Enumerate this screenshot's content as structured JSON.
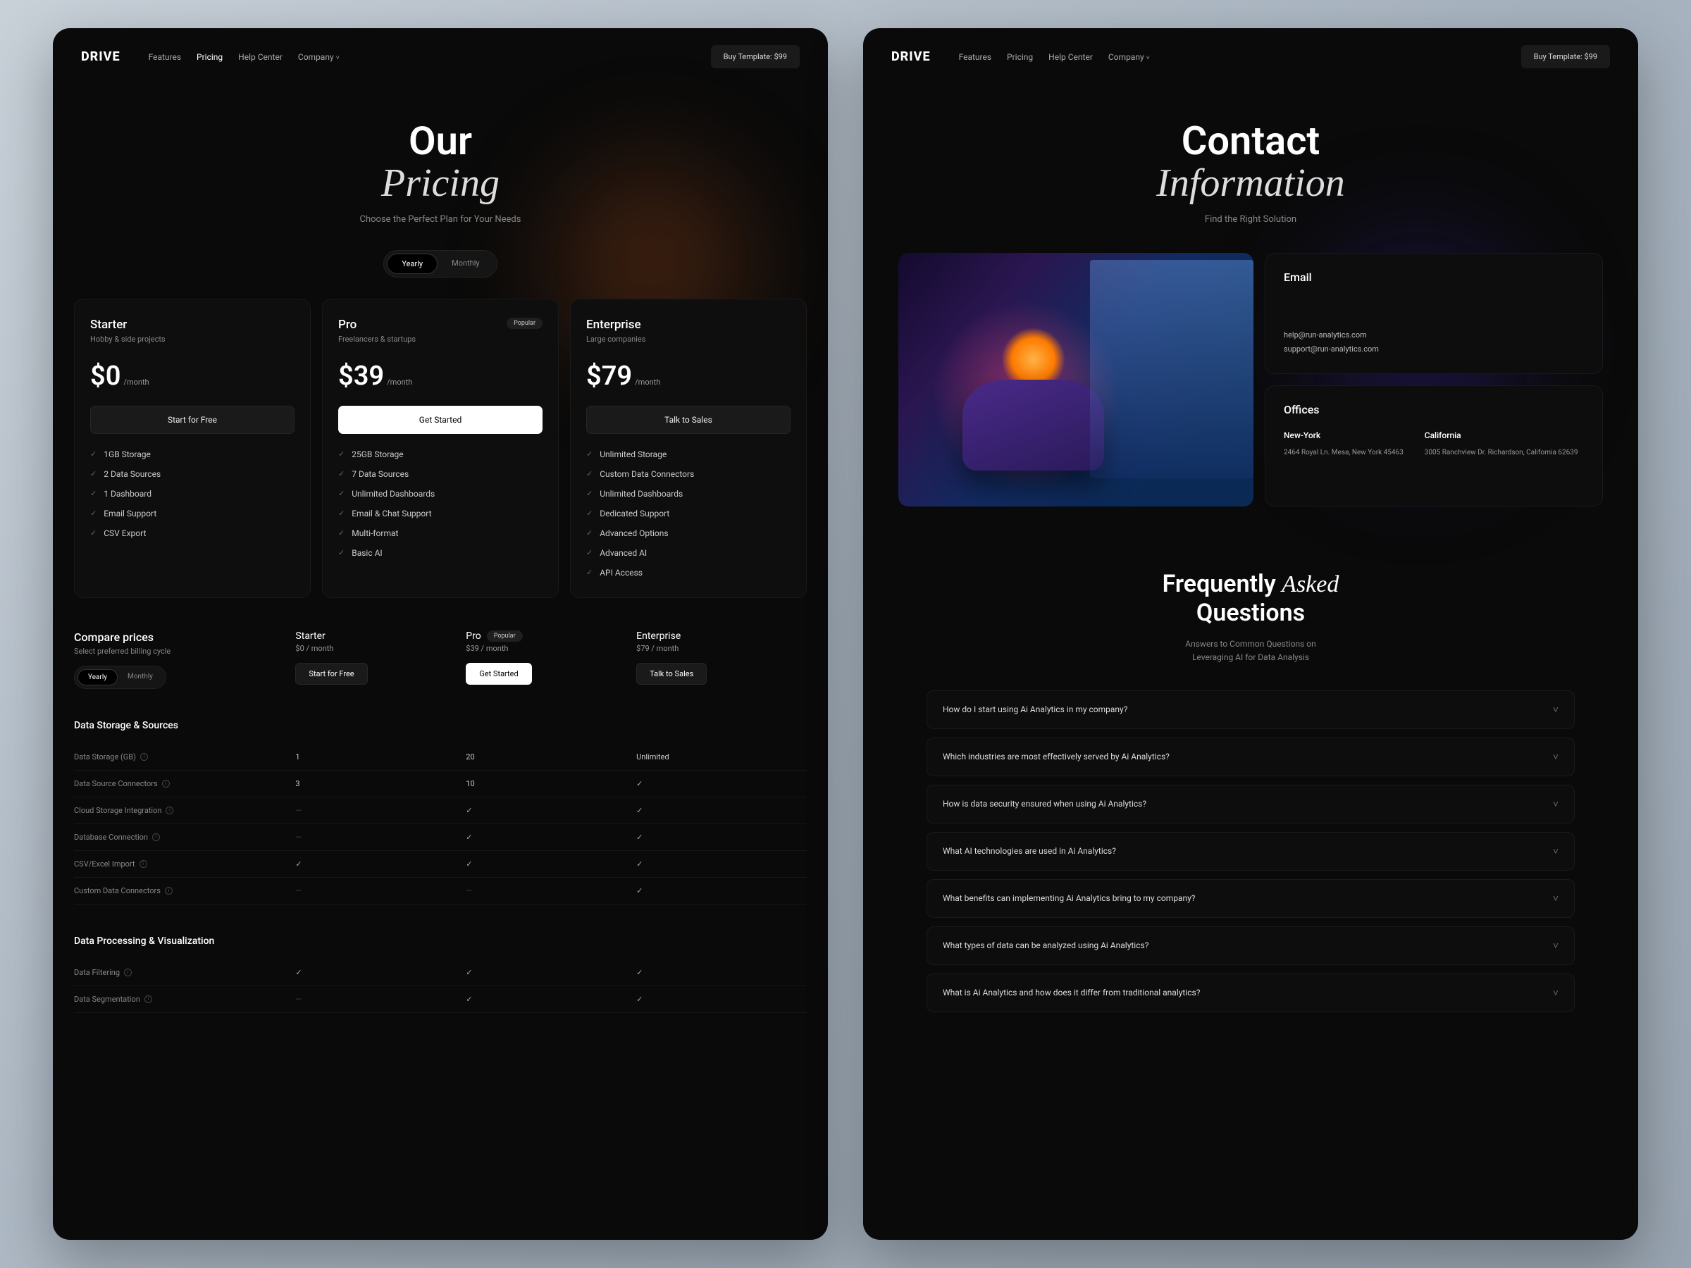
{
  "header": {
    "logo": "DRIVE",
    "nav": [
      "Features",
      "Pricing",
      "Help Center",
      "Company"
    ],
    "nav_active": 1,
    "cta": "Buy Template: $99"
  },
  "pricing_hero": {
    "title_a": "Our",
    "title_b": "Pricing",
    "sub": "Choose the Perfect Plan for Your Needs",
    "toggle": {
      "yearly": "Yearly",
      "monthly": "Monthly",
      "active": "yearly"
    }
  },
  "plans": [
    {
      "name": "Starter",
      "tag": "Hobby & side projects",
      "price": "$0",
      "period": "/month",
      "cta": "Start for Free",
      "cta_style": "dark",
      "popular": false,
      "features": [
        "1GB Storage",
        "2 Data Sources",
        "1 Dashboard",
        "Email Support",
        "CSV Export"
      ]
    },
    {
      "name": "Pro",
      "tag": "Freelancers & startups",
      "price": "$39",
      "period": "/month",
      "cta": "Get Started",
      "cta_style": "white",
      "popular": true,
      "popular_label": "Popular",
      "features": [
        "25GB Storage",
        "7 Data Sources",
        "Unlimited Dashboards",
        "Email & Chat Support",
        "Multi-format",
        "Basic AI"
      ]
    },
    {
      "name": "Enterprise",
      "tag": "Large companies",
      "price": "$79",
      "period": "/month",
      "cta": "Talk to Sales",
      "cta_style": "dark",
      "popular": false,
      "features": [
        "Unlimited Storage",
        "Custom Data Connectors",
        "Unlimited Dashboards",
        "Dedicated Support",
        "Advanced Options",
        "Advanced AI",
        "API Access"
      ]
    }
  ],
  "compare": {
    "title": "Compare prices",
    "sub": "Select preferred billing cycle",
    "toggle": {
      "yearly": "Yearly",
      "monthly": "Monthly",
      "active": "yearly"
    },
    "cols": [
      {
        "name": "Starter",
        "price": "$0 / month",
        "cta": "Start for Free",
        "cta_style": "dark",
        "popular": false
      },
      {
        "name": "Pro",
        "price": "$39 / month",
        "cta": "Get Started",
        "cta_style": "white",
        "popular": true,
        "popular_label": "Popular"
      },
      {
        "name": "Enterprise",
        "price": "$79 / month",
        "cta": "Talk to Sales",
        "cta_style": "dark",
        "popular": false
      }
    ],
    "sections": [
      {
        "heading": "Data Storage & Sources",
        "rows": [
          {
            "label": "Data Storage (GB)",
            "v": [
              "1",
              "20",
              "Unlimited"
            ]
          },
          {
            "label": "Data Source Connectors",
            "v": [
              "3",
              "10",
              "check"
            ]
          },
          {
            "label": "Cloud Storage Integration",
            "v": [
              "dash",
              "check",
              "check"
            ]
          },
          {
            "label": "Database Connection",
            "v": [
              "dash",
              "check",
              "check"
            ]
          },
          {
            "label": "CSV/Excel Import",
            "v": [
              "check",
              "check",
              "check"
            ]
          },
          {
            "label": "Custom Data Connectors",
            "v": [
              "dash",
              "dash",
              "check"
            ]
          }
        ]
      },
      {
        "heading": "Data Processing & Visualization",
        "rows": [
          {
            "label": "Data Filtering",
            "v": [
              "check",
              "check",
              "check"
            ]
          },
          {
            "label": "Data Segmentation",
            "v": [
              "dash",
              "check",
              "check"
            ]
          }
        ]
      }
    ]
  },
  "contact_hero": {
    "title_a": "Contact",
    "title_b": "Information",
    "sub": "Find the Right Solution"
  },
  "contact": {
    "email": {
      "title": "Email",
      "lines": [
        "help@run-analytics.com",
        "support@run-analytics.com"
      ]
    },
    "offices": {
      "title": "Offices",
      "list": [
        {
          "city": "New-York",
          "addr": "2464 Royal Ln. Mesa, New York 45463"
        },
        {
          "city": "California",
          "addr": "3005 Ranchview Dr. Richardson, California 62639"
        }
      ]
    }
  },
  "faq": {
    "title_a": "Frequently ",
    "title_b": "Asked",
    "title_c": "Questions",
    "sub1": "Answers to Common Questions on",
    "sub2": "Leveraging AI for Data Analysis",
    "items": [
      "How do I start using Ai Analytics in my company?",
      "Which industries are most effectively served by Ai Analytics?",
      "How is data security ensured when using Ai Analytics?",
      "What AI technologies are used in Ai Analytics?",
      "What benefits can implementing Ai Analytics bring to my company?",
      "What types of data can be analyzed using Ai Analytics?",
      "What is Ai Analytics and how does it differ from traditional analytics?"
    ]
  }
}
